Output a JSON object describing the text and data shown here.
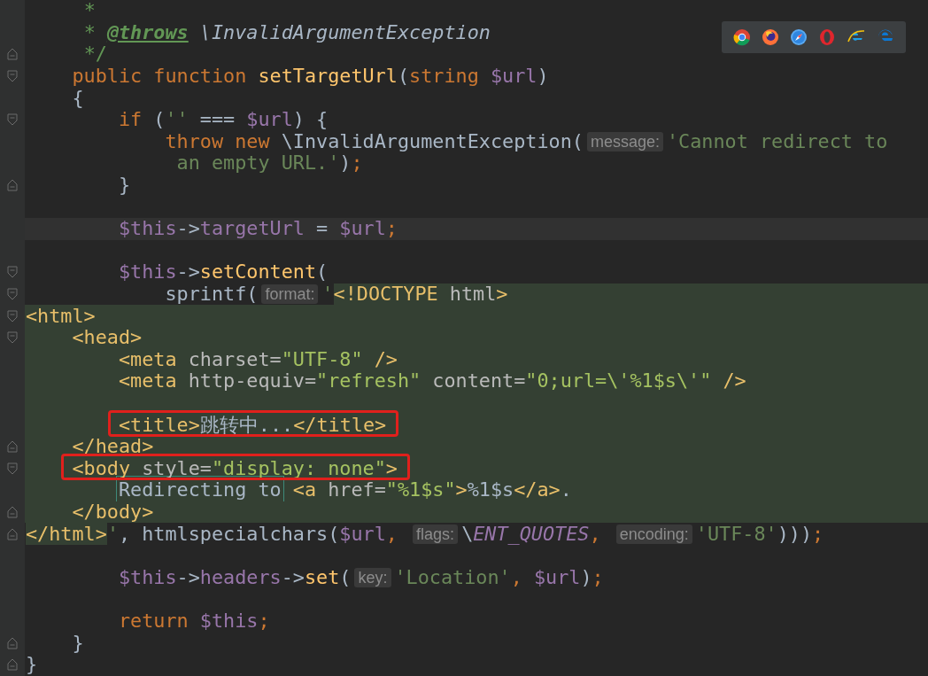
{
  "lines": [
    {
      "tokens": [
        {
          "text": "     *",
          "kind": "comment"
        }
      ]
    },
    {
      "tokens": [
        {
          "text": "     * ",
          "kind": "comment"
        },
        {
          "text": "@throws",
          "kind": "doctag"
        },
        {
          "text": " \\InvalidArgumentException",
          "kind": "docref"
        }
      ]
    },
    {
      "fold_closes": true,
      "tokens": [
        {
          "text": "     */",
          "kind": "comment"
        }
      ]
    },
    {
      "fold_opens": true,
      "tokens": [
        {
          "text": "    public function ",
          "kind": "keyword"
        },
        {
          "text": "setTargetUrl",
          "kind": "function"
        },
        {
          "text": "(",
          "kind": "plain"
        },
        {
          "text": "string ",
          "kind": "keyword"
        },
        {
          "text": "$url",
          "kind": "variable"
        },
        {
          "text": ")",
          "kind": "plain"
        }
      ]
    },
    {
      "tokens": [
        {
          "text": "    {",
          "kind": "plain"
        }
      ]
    },
    {
      "fold_opens": true,
      "tokens": [
        {
          "text": "        if ",
          "kind": "keyword"
        },
        {
          "text": "(",
          "kind": "plain"
        },
        {
          "text": "''",
          "kind": "string"
        },
        {
          "text": " === ",
          "kind": "plain"
        },
        {
          "text": "$url",
          "kind": "variable"
        },
        {
          "text": ") {",
          "kind": "plain"
        }
      ]
    },
    {
      "tokens": [
        {
          "text": "            throw new ",
          "kind": "keyword"
        },
        {
          "text": "\\InvalidArgumentException(",
          "kind": "plain"
        },
        {
          "text": "message:",
          "kind": "hint"
        },
        {
          "text": "'Cannot redirect to",
          "kind": "string"
        }
      ]
    },
    {
      "tokens": [
        {
          "text": "             an empty URL.'",
          "kind": "string"
        },
        {
          "text": ")",
          "kind": "plain"
        },
        {
          "text": ";",
          "kind": "keyword"
        }
      ]
    },
    {
      "fold_closes": true,
      "tokens": [
        {
          "text": "        }",
          "kind": "plain"
        }
      ]
    },
    {
      "blank_line_before": true,
      "current": true,
      "tokens": [
        {
          "text": "        $this",
          "kind": "variable"
        },
        {
          "text": "->",
          "kind": "plain"
        },
        {
          "text": "targetUrl",
          "kind": "variable"
        },
        {
          "text": " = ",
          "kind": "plain"
        },
        {
          "text": "$url",
          "kind": "variable"
        },
        {
          "text": ";",
          "kind": "keyword"
        }
      ]
    },
    {
      "blank_line_before": true,
      "fold_opens": true,
      "tokens": [
        {
          "text": "        $this",
          "kind": "variable"
        },
        {
          "text": "->",
          "kind": "plain"
        },
        {
          "text": "setContent",
          "kind": "function"
        },
        {
          "text": "(",
          "kind": "plain"
        }
      ]
    },
    {
      "fold_opens": true,
      "tokens": [
        {
          "text": "            sprintf(",
          "kind": "plain"
        },
        {
          "text": "format:",
          "kind": "hint"
        },
        {
          "text": "'",
          "kind": "string"
        },
        {
          "text": "<!DOCTYPE",
          "kind": "tag",
          "injected": true
        },
        {
          "text": " html",
          "kind": "attr",
          "injected": true
        },
        {
          "text": ">",
          "kind": "tag",
          "injected": true
        }
      ]
    },
    {
      "injected": true,
      "fold_opens": true,
      "tokens": [
        {
          "text": "<html>",
          "kind": "tag"
        }
      ]
    },
    {
      "injected": true,
      "fold_opens": true,
      "tokens": [
        {
          "text": "    <head>",
          "kind": "tag"
        }
      ]
    },
    {
      "injected": true,
      "tokens": [
        {
          "text": "        <meta ",
          "kind": "tag"
        },
        {
          "text": "charset=",
          "kind": "attr"
        },
        {
          "text": "\"UTF-8\"",
          "kind": "value"
        },
        {
          "text": " />",
          "kind": "tag"
        }
      ]
    },
    {
      "injected": true,
      "tokens": [
        {
          "text": "        <meta ",
          "kind": "tag"
        },
        {
          "text": "http-equiv=",
          "kind": "attr"
        },
        {
          "text": "\"refresh\"",
          "kind": "value"
        },
        {
          "text": " content=",
          "kind": "attr"
        },
        {
          "text": "\"0;url=\\'%1$s\\'\"",
          "kind": "value"
        },
        {
          "text": " />",
          "kind": "tag"
        }
      ]
    },
    {
      "injected": true
    },
    {
      "injected": true,
      "boxed": true,
      "tokens": [
        {
          "text": "        <title>",
          "kind": "tag"
        },
        {
          "text": "跳转中...",
          "kind": "plain"
        },
        {
          "text": "</title>",
          "kind": "tag"
        }
      ]
    },
    {
      "injected": true,
      "fold_closes": true,
      "tokens": [
        {
          "text": "    </head>",
          "kind": "tag"
        }
      ]
    },
    {
      "injected": true,
      "boxed": true,
      "fold_opens": true,
      "tokens": [
        {
          "text": "    <body ",
          "kind": "tag"
        },
        {
          "text": "style=",
          "kind": "attr"
        },
        {
          "text": "\"display: none\"",
          "kind": "value"
        },
        {
          "text": ">",
          "kind": "tag"
        }
      ]
    },
    {
      "injected": true,
      "tokens": [
        {
          "text": "        Redirecting to",
          "kind": "marked"
        },
        {
          "text": " <a ",
          "kind": "tag"
        },
        {
          "text": "href=",
          "kind": "attr"
        },
        {
          "text": "\"%1$s\"",
          "kind": "value"
        },
        {
          "text": ">",
          "kind": "tag"
        },
        {
          "text": "%1$s",
          "kind": "plain"
        },
        {
          "text": "</a>",
          "kind": "tag"
        },
        {
          "text": ".",
          "kind": "plain"
        }
      ]
    },
    {
      "injected": true,
      "fold_closes": true,
      "tokens": [
        {
          "text": "    </body>",
          "kind": "tag"
        }
      ]
    },
    {
      "fold_closes": true,
      "tokens": [
        {
          "text": "</html>",
          "kind": "tag",
          "injected": true
        },
        {
          "text": "'",
          "kind": "string"
        },
        {
          "text": ", htmlspecialchars(",
          "kind": "plain"
        },
        {
          "text": "$url",
          "kind": "variable"
        },
        {
          "text": ", ",
          "kind": "keyword"
        },
        {
          "text": "flags:",
          "kind": "hint"
        },
        {
          "text": "\\",
          "kind": "plain"
        },
        {
          "text": "ENT_QUOTES",
          "kind": "constant"
        },
        {
          "text": ", ",
          "kind": "keyword"
        },
        {
          "text": "encoding:",
          "kind": "hint"
        },
        {
          "text": "'UTF-8'",
          "kind": "string"
        },
        {
          "text": ")))",
          "kind": "plain"
        },
        {
          "text": ";",
          "kind": "keyword"
        }
      ]
    },
    {
      "blank_line_before": true,
      "tokens": [
        {
          "text": "        $this",
          "kind": "variable"
        },
        {
          "text": "->",
          "kind": "plain"
        },
        {
          "text": "headers",
          "kind": "variable"
        },
        {
          "text": "->",
          "kind": "plain"
        },
        {
          "text": "set",
          "kind": "function"
        },
        {
          "text": "(",
          "kind": "plain"
        },
        {
          "text": "key:",
          "kind": "hint"
        },
        {
          "text": "'Location'",
          "kind": "string"
        },
        {
          "text": ", ",
          "kind": "keyword"
        },
        {
          "text": "$url",
          "kind": "variable"
        },
        {
          "text": ")",
          "kind": "plain"
        },
        {
          "text": ";",
          "kind": "keyword"
        }
      ]
    },
    {
      "blank_line_before": true,
      "tokens": [
        {
          "text": "        return ",
          "kind": "keyword"
        },
        {
          "text": "$this",
          "kind": "variable"
        },
        {
          "text": ";",
          "kind": "keyword"
        }
      ]
    },
    {
      "fold_closes": true,
      "tokens": [
        {
          "text": "    }",
          "kind": "plain"
        }
      ]
    },
    {
      "fold_closes": true,
      "tokens": [
        {
          "text": "}",
          "kind": "plain"
        }
      ]
    }
  ]
}
